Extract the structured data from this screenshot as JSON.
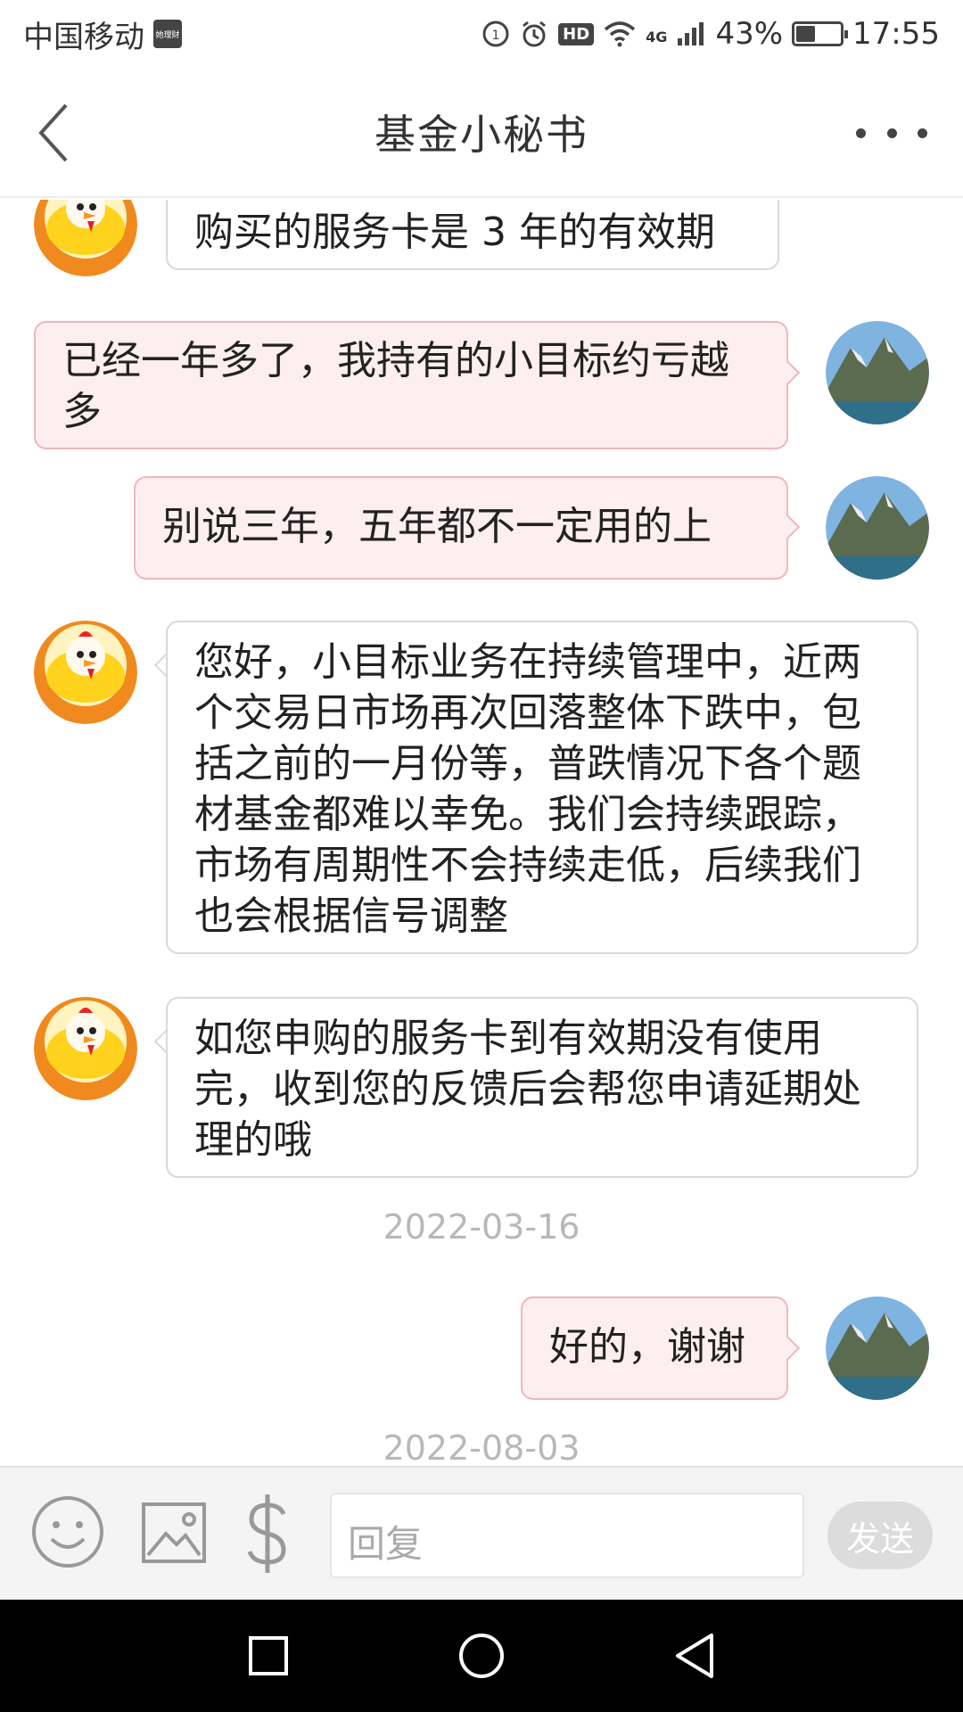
{
  "status_bar": {
    "carrier": "中国移动",
    "carrier_badge": "她理财",
    "network": "4G",
    "battery_percent": "43%",
    "battery_level": 0.43,
    "time": "17:55",
    "hd": "HD"
  },
  "nav": {
    "title": "基金小秘书"
  },
  "messages": [
    {
      "side": "in",
      "avatar": "rooster-avatar",
      "text": "购买的服务卡是 3 年的有效期"
    },
    {
      "side": "out",
      "avatar": "mountain-avatar",
      "text": "已经一年多了，我持有的小目标约亏越多"
    },
    {
      "side": "out",
      "avatar": "mountain-avatar",
      "text": "别说三年，五年都不一定用的上"
    },
    {
      "side": "in",
      "avatar": "rooster-avatar",
      "text": "您好，小目标业务在持续管理中，近两个交易日市场再次回落整体下跌中，包括之前的一月份等，普跌情况下各个题材基金都难以幸免。我们会持续跟踪，市场有周期性不会持续走低，后续我们也会根据信号调整"
    },
    {
      "side": "in",
      "avatar": "rooster-avatar",
      "text": "如您申购的服务卡到有效期没有使用完，收到您的反馈后会帮您申请延期处理的哦"
    },
    {
      "side": "out",
      "avatar": "mountain-avatar",
      "text": "好的，谢谢"
    }
  ],
  "timestamps": [
    "2022-03-16",
    "2022-08-03"
  ],
  "input": {
    "placeholder": "回复",
    "send_label": "发送"
  },
  "colors": {
    "outgoing_bubble": "#fdeeef",
    "outgoing_border": "#efb6be",
    "incoming_border": "#d9d9d9"
  }
}
